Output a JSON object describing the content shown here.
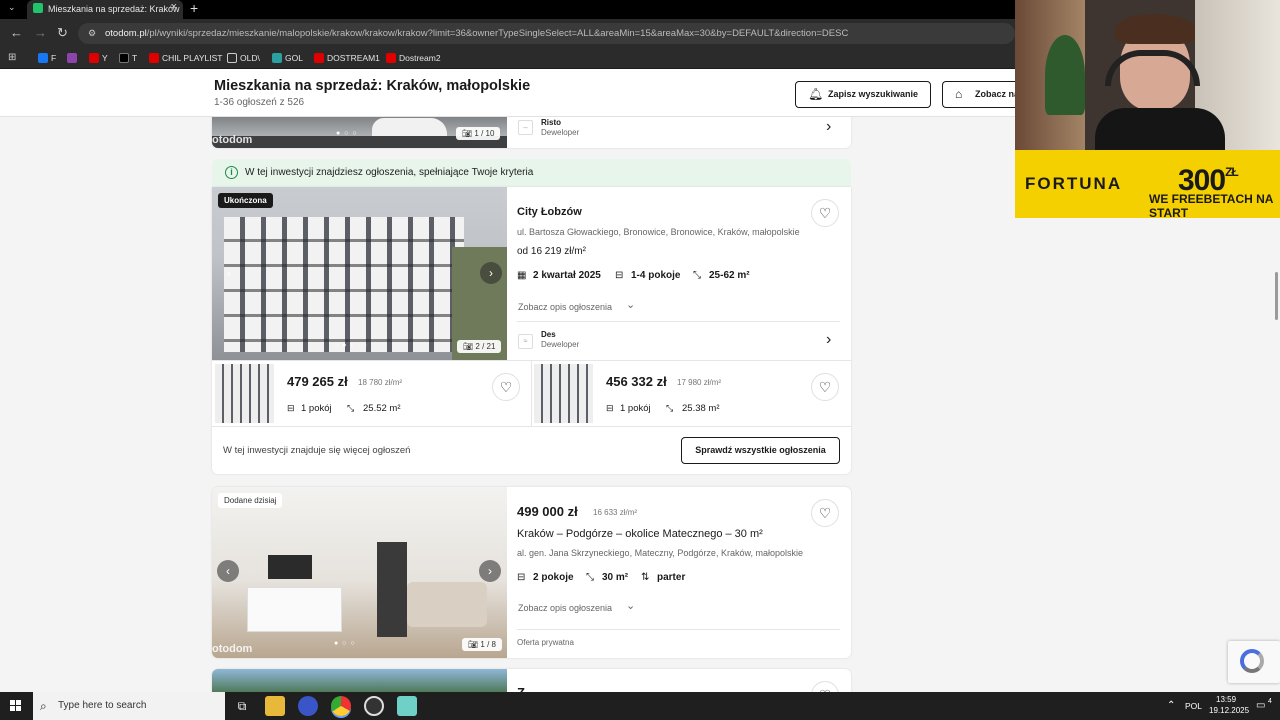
{
  "browser": {
    "tab_title": "Mieszkania na sprzedaż: Kraków",
    "url_host": "otodom.pl",
    "url_path": "/pl/wyniki/sprzedaz/mieszkanie/malopolskie/krakow/krakow/krakow?limit=36&ownerTypeSingleSelect=ALL&areaMin=15&areaMax=30&by=DEFAULT&direction=DESC",
    "bookmarks": [
      {
        "label": "F",
        "color": "#1877f2"
      },
      {
        "label": "",
        "color": "#8e44ad"
      },
      {
        "label": "Y",
        "color": "#e00000"
      },
      {
        "label": "T",
        "color": "#000000"
      },
      {
        "label": "CHIL PLAYLIST",
        "color": "#e00000"
      },
      {
        "label": "OLD\\",
        "color": "#888888"
      },
      {
        "label": "GOL",
        "color": "#2aa0a0"
      },
      {
        "label": "DOSTREAM1",
        "color": "#e00000"
      },
      {
        "label": "Dostream2",
        "color": "#e00000"
      }
    ]
  },
  "header": {
    "title": "Mieszkania na sprzedaż: Kraków, małopolskie",
    "subtitle": "1-36 ogłoszeń z 526",
    "save_search": "Zapisz wyszukiwanie",
    "see_map": "Zobacz na"
  },
  "top_card": {
    "counter": "1 / 10",
    "watermark": "otodom",
    "developer_name": "Risto",
    "developer_role": "Deweloper"
  },
  "investment": {
    "notice": "W tej inwestycji znajdziesz ogłoszenia, spełniające Twoje kryteria",
    "badge": "Ukończona",
    "name": "City Łobzów",
    "address": "ul. Bartosza Głowackiego, Bronowice, Bronowice, Kraków, małopolskie",
    "price_from": "od 16 219 zł/m²",
    "date": "2 kwartał 2025",
    "rooms": "1-4 pokoje",
    "area": "25-62 m²",
    "description_link": "Zobacz opis ogłoszenia",
    "developer_name": "Des",
    "developer_role": "Deweloper",
    "counter": "2 / 21",
    "units": [
      {
        "price": "479 265 zł",
        "per_m2": "18 780 zł/m²",
        "rooms": "1 pokój",
        "area": "25.52 m²"
      },
      {
        "price": "456 332 zł",
        "per_m2": "17 980 zł/m²",
        "rooms": "1 pokój",
        "area": "25.38 m²"
      }
    ],
    "more_text": "W tej inwestycji znajduje się więcej ogłoszeń",
    "check_all": "Sprawdź wszystkie ogłoszenia"
  },
  "listing": {
    "badge": "Dodane dzisiaj",
    "price": "499 000 zł",
    "per_m2": "16 633 zł/m²",
    "title": "Kraków – Podgórze – okolice Matecznego – 30 m²",
    "address": "al. gen. Jana Skrzyneckiego, Mateczny, Podgórze, Kraków, małopolskie",
    "rooms": "2 pokoje",
    "area": "30 m²",
    "floor": "parter",
    "description_link": "Zobacz opis ogłoszenia",
    "seller": "Oferta prywatna",
    "counter": "1 / 8",
    "watermark": "otodom"
  },
  "next_card": {
    "title_partial": "Z"
  },
  "overlay": {
    "brand": "FORTUNA",
    "amount": "300",
    "currency": "ZŁ",
    "promo": "WE FREEBETACH NA START"
  },
  "taskbar": {
    "search_placeholder": "Type here to search",
    "language": "POL",
    "time": "13:59",
    "date": "19.12.2025",
    "notifications": "4"
  },
  "colors": {
    "accent": "#1e8a4a",
    "notice_bg": "#e7f5ea",
    "fortuna_yellow": "#f5d000"
  }
}
